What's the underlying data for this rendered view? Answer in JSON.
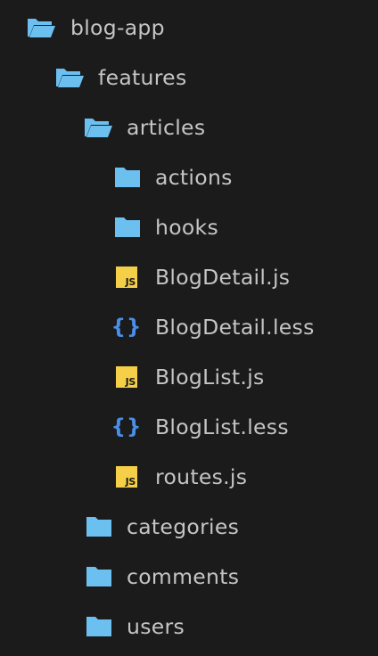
{
  "colors": {
    "background": "#1b1b1c",
    "folder": "#6cc0f0",
    "text": "#c5c5c5",
    "js_badge": "#f5cf47",
    "less_braces": "#4a8ee6"
  },
  "tree": [
    {
      "label": "blog-app",
      "icon": "folder-open-icon"
    },
    {
      "label": "features",
      "icon": "folder-open-icon"
    },
    {
      "label": "articles",
      "icon": "folder-open-icon"
    },
    {
      "label": "actions",
      "icon": "folder-icon"
    },
    {
      "label": "hooks",
      "icon": "folder-icon"
    },
    {
      "label": "BlogDetail.js",
      "icon": "js-file-icon",
      "badge": "JS"
    },
    {
      "label": "BlogDetail.less",
      "icon": "less-file-icon",
      "glyph": "{}"
    },
    {
      "label": "BlogList.js",
      "icon": "js-file-icon",
      "badge": "JS"
    },
    {
      "label": "BlogList.less",
      "icon": "less-file-icon",
      "glyph": "{}"
    },
    {
      "label": "routes.js",
      "icon": "js-file-icon",
      "badge": "JS"
    },
    {
      "label": "categories",
      "icon": "folder-icon"
    },
    {
      "label": "comments",
      "icon": "folder-icon"
    },
    {
      "label": "users",
      "icon": "folder-icon"
    }
  ]
}
